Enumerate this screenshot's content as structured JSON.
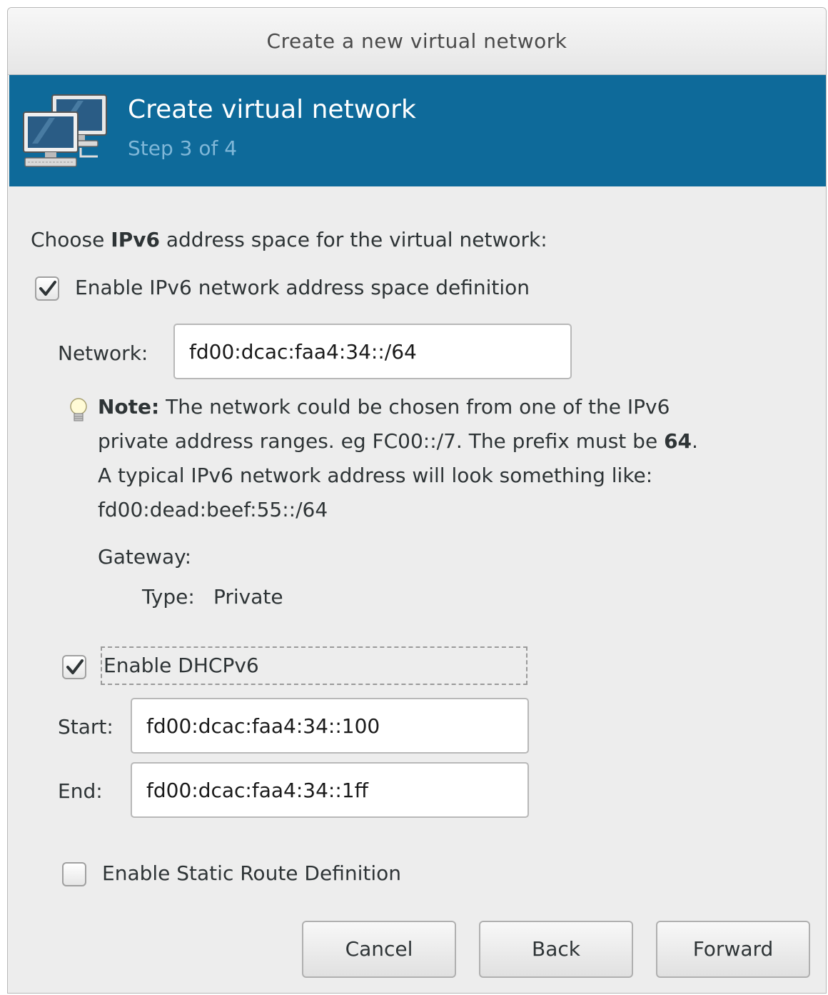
{
  "window": {
    "title": "Create a new virtual network"
  },
  "banner": {
    "title": "Create virtual network",
    "step": "Step 3 of 4",
    "icon": "network-computers-icon"
  },
  "content": {
    "choose_prefix": "Choose ",
    "choose_bold": "IPv6",
    "choose_suffix": " address space for the virtual network:",
    "enable_ipv6_label": "Enable IPv6 network address space definition",
    "enable_ipv6_checked": true,
    "network_label": "Network:",
    "network_value": "fd00:dcac:faa4:34::/64",
    "note": {
      "icon": "lightbulb-icon",
      "bold": "Note:",
      "line1": " The network could be chosen from one of the IPv6",
      "line2_prefix": "private address ranges. eg FC00::/7.  The prefix must be ",
      "line2_bold": "64",
      "line2_suffix": ".",
      "line3": "A typical IPv6 network address will look something like:",
      "line4": "fd00:dead:beef:55::/64"
    },
    "gateway_label": "Gateway:",
    "type_label": "Type:",
    "type_value": "Private",
    "enable_dhcp_label": "Enable DHCPv6",
    "enable_dhcp_checked": true,
    "start_label": "Start:",
    "start_value": "fd00:dcac:faa4:34::100",
    "end_label": "End:",
    "end_value": "fd00:dcac:faa4:34::1ff",
    "static_route_label": "Enable Static Route Definition",
    "static_route_checked": false
  },
  "buttons": {
    "cancel": "Cancel",
    "back": "Back",
    "forward": "Forward"
  },
  "colors": {
    "banner": "#0e6a9a",
    "banner_step": "#7fb7d8",
    "dialog_bg": "#ededed"
  }
}
